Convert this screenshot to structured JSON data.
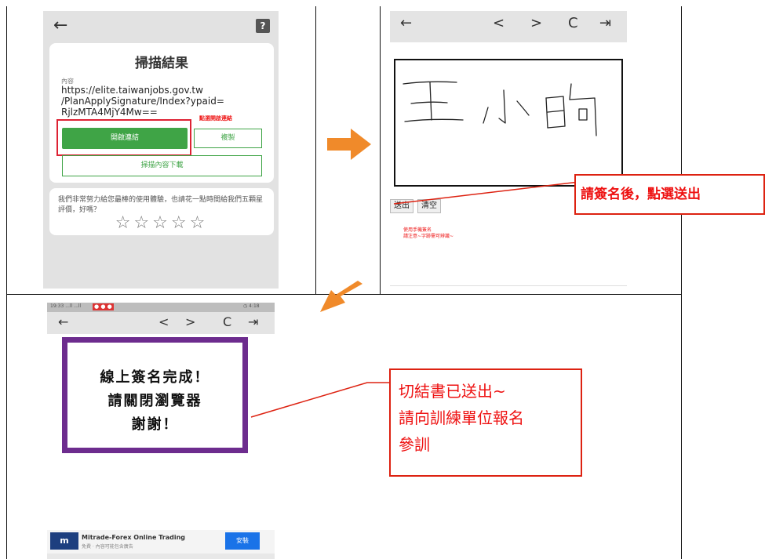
{
  "panel1": {
    "back_icon": "←",
    "help_icon": "?",
    "title": "掃描結果",
    "content_label": "內容",
    "url_lines": [
      "https://elite.taiwanjobs.gov.tw",
      "/PlanApplySignature/Index?ypaid=",
      "RjlzMTA4MjY4Mw=="
    ],
    "note": "點選開啟連結",
    "open_link_label": "開啟連結",
    "copy_label": "複製",
    "download_label": "掃描內容下載",
    "rating_text": "我們非常努力給您最棒的使用體驗，也請花一點時間給我們五顆星評價，好嗎？",
    "stars": "☆☆☆☆☆",
    "accent": "#3fa446"
  },
  "panel2": {
    "back_icon": "←",
    "prev_icon": "<",
    "next_icon": ">",
    "reload_icon": "C",
    "exit_icon": "⇥",
    "send_label": "送出",
    "clear_label": "清空",
    "notes": [
      "使用手機簽名",
      "請注意~字跡需可辨識~"
    ],
    "callout": "請簽名後，點選送出"
  },
  "panel3": {
    "status_left": "19:33  ...ll  ...ll",
    "status_right": "◷ 4:18",
    "toolbar": {
      "back_icon": "←",
      "prev_icon": "<",
      "next_icon": ">",
      "reload_icon": "C",
      "exit_icon": "⇥"
    },
    "message_lines": [
      "線上簽名完成！",
      "請關閉瀏覽器",
      "謝謝！"
    ],
    "callout_lines": [
      "切結書已送出~",
      "請向訓練單位報名",
      "參訓"
    ],
    "ad_title": "Mitrade-Forex Online Trading",
    "ad_sub": "免費 · 內容可能包含廣告",
    "ad_button": "安裝",
    "frame_color": "#6d2c8e"
  }
}
